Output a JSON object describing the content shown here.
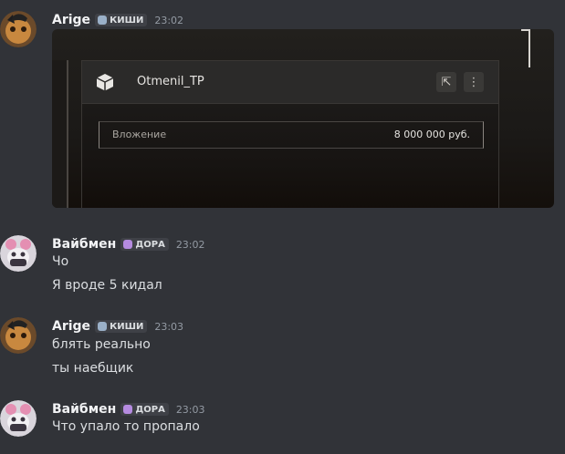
{
  "messages": [
    {
      "author": "Arige",
      "tag": "КИШИ",
      "tag_icon": "skull-icon",
      "time": "23:02",
      "embed": {
        "title": "Otmenil_TP",
        "invest_label": "Вложение",
        "invest_value": "8 000 000 руб."
      }
    },
    {
      "author": "Вайбмен",
      "tag": "ДОРА",
      "tag_icon": "skull-purple-icon",
      "time": "23:02",
      "lines": [
        "Чо",
        "Я вроде 5 кидал"
      ]
    },
    {
      "author": "Arige",
      "tag": "КИШИ",
      "tag_icon": "skull-icon",
      "time": "23:03",
      "lines": [
        "блять реально",
        "ты наебщик"
      ]
    },
    {
      "author": "Вайбмен",
      "tag": "ДОРА",
      "tag_icon": "skull-purple-icon",
      "time": "23:03",
      "lines": [
        "Что упало то пропало"
      ]
    }
  ],
  "colors": {
    "background": "#313338",
    "username": "#f2f3f5",
    "timestamp": "#949ba4",
    "tag_bg": "#3f4147"
  }
}
